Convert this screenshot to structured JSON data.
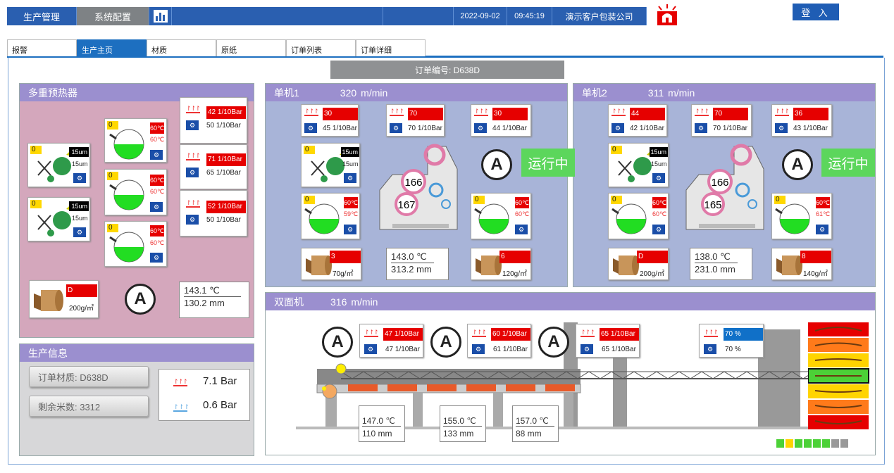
{
  "topbar": {
    "menu1": "生产管理",
    "menu2": "系统配置",
    "date": "2022-09-02",
    "time": "09:45:19",
    "company": "演示客户包装公司",
    "login": "登 入"
  },
  "tabs": [
    "报警",
    "生产主页",
    "材质",
    "原纸",
    "订单列表",
    "订单详细"
  ],
  "order_banner": "订单编号: D638D",
  "preheater": {
    "title": "多重预热器",
    "pressures": [
      {
        "top": "42 1/10Bar",
        "bottom": "50 1/10Bar"
      },
      {
        "top": "71 1/10Bar",
        "bottom": "65 1/10Bar"
      },
      {
        "top": "52 1/10Bar",
        "bottom": "50 1/10Bar"
      }
    ],
    "splicers": [
      {
        "badge": "0",
        "top": "15um",
        "bottom": "15um"
      },
      {
        "badge": "0",
        "top": "15um",
        "bottom": "15um"
      }
    ],
    "tanks": [
      {
        "badge": "0",
        "set": "60℃",
        "act": "60℃"
      },
      {
        "badge": "0",
        "set": "60℃",
        "act": "60℃"
      },
      {
        "badge": "0",
        "set": "60℃",
        "act": "60℃"
      }
    ],
    "roll": {
      "code": "D",
      "weight": "200g/㎡"
    },
    "auto": "A",
    "temp": "143.1 ℃",
    "speed": "130.2 mm"
  },
  "info": {
    "title": "生产信息",
    "material": "订单材质: D638D",
    "remaining": "剩余米数: 3312",
    "p1": "7.1 Bar",
    "p2": "0.6 Bar"
  },
  "unit1": {
    "title": "单机1",
    "speed": "320",
    "unit": "m/min",
    "pressures": [
      {
        "top": "30 1/10Bar",
        "bottom": "45 1/10Bar"
      },
      {
        "top": "70 1/10Bar",
        "bottom": "70 1/10Bar"
      },
      {
        "top": "30 1/10Bar",
        "bottom": "44 1/10Bar"
      }
    ],
    "splicer": {
      "badge": "0",
      "top": "15um",
      "bottom": "15um"
    },
    "tanks": [
      {
        "badge": "0",
        "set": "60℃",
        "act": "59℃"
      },
      {
        "badge": "0",
        "set": "60℃",
        "act": "60℃"
      }
    ],
    "rolls": [
      {
        "code": "3",
        "weight": "70g/㎡"
      },
      {
        "code": "6",
        "weight": "120g/㎡"
      }
    ],
    "machine_top": "166",
    "machine_bottom": "167",
    "temp": "143.0 ℃",
    "length": "313.2 mm",
    "status": "运行中",
    "auto": "A"
  },
  "unit2": {
    "title": "单机2",
    "speed": "311",
    "unit": "m/min",
    "pressures": [
      {
        "top": "44 1/10Bar",
        "bottom": "42 1/10Bar"
      },
      {
        "top": "70 1/10Bar",
        "bottom": "70 1/10Bar"
      },
      {
        "top": "36 1/10Bar",
        "bottom": "43 1/10Bar"
      }
    ],
    "splicer": {
      "badge": "0",
      "top": "15um",
      "bottom": "15um"
    },
    "tanks": [
      {
        "badge": "0",
        "set": "60℃",
        "act": "60℃"
      },
      {
        "badge": "0",
        "set": "60℃",
        "act": "61℃"
      }
    ],
    "rolls": [
      {
        "code": "D",
        "weight": "200g/㎡"
      },
      {
        "code": "8",
        "weight": "140g/㎡"
      }
    ],
    "machine_top": "166",
    "machine_bottom": "165",
    "temp": "138.0 ℃",
    "length": "231.0 mm",
    "status": "运行中",
    "auto": "A"
  },
  "double": {
    "title": "双面机",
    "speed": "316",
    "unit": "m/min",
    "pressures": [
      {
        "top": "47 1/10Bar",
        "bottom": "47 1/10Bar"
      },
      {
        "top": "60 1/10Bar",
        "bottom": "61 1/10Bar"
      },
      {
        "top": "65 1/10Bar",
        "bottom": "65 1/10Bar"
      }
    ],
    "percent": {
      "top": "70 %",
      "bottom": "70 %"
    },
    "zones": [
      {
        "temp": "147.0 ℃",
        "len": "110 mm"
      },
      {
        "temp": "155.0 ℃",
        "len": "133 mm"
      },
      {
        "temp": "157.0 ℃",
        "len": "88 mm"
      }
    ],
    "auto": "A"
  },
  "colors": {
    "accent": "#2a5fb0",
    "panel_header": "#9b8fcf",
    "alarm": "#e60000",
    "run": "#5cd65c"
  }
}
